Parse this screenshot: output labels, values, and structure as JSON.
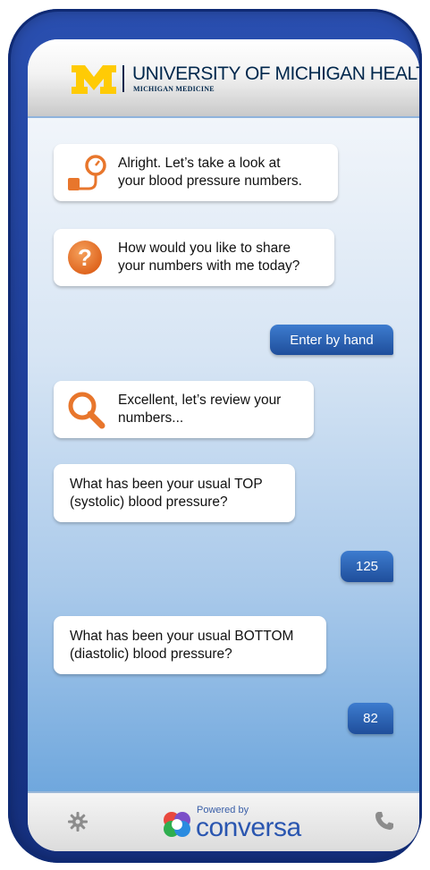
{
  "header": {
    "title": "UNIVERSITY OF MICHIGAN HEALTH",
    "subtitle": "MICHIGAN MEDICINE"
  },
  "messages": [
    {
      "from": "bot",
      "icon": "blood-pressure-gauge-icon",
      "text_line1": "Alright. Let’s take a look at",
      "text_line2": "your blood pressure numbers."
    },
    {
      "from": "bot",
      "icon": "question-mark-icon",
      "text_line1": "How would you like to share",
      "text_line2": "your numbers with me today?"
    },
    {
      "from": "user",
      "text": "Enter by hand"
    },
    {
      "from": "bot",
      "icon": "magnifier-icon",
      "text_line1": "Excellent, let’s review your",
      "text_line2": "numbers..."
    },
    {
      "from": "bot",
      "text_line1": "What has been your usual TOP",
      "text_line2": "(systolic) blood pressure?"
    },
    {
      "from": "user",
      "text": "125"
    },
    {
      "from": "bot",
      "text_line1": "What has been your usual BOTTOM",
      "text_line2": "(diastolic) blood pressure?"
    },
    {
      "from": "user",
      "text": "82"
    }
  ],
  "footer": {
    "powered_by": "Powered by",
    "brand": "conversa",
    "settings_icon": "gear-icon",
    "call_icon": "phone-icon"
  },
  "colors": {
    "frame": "#1d3d98",
    "accent_orange": "#e8762c",
    "michigan_maize": "#ffcb05",
    "michigan_blue": "#00274c",
    "user_bubble": "#2a63b8"
  }
}
